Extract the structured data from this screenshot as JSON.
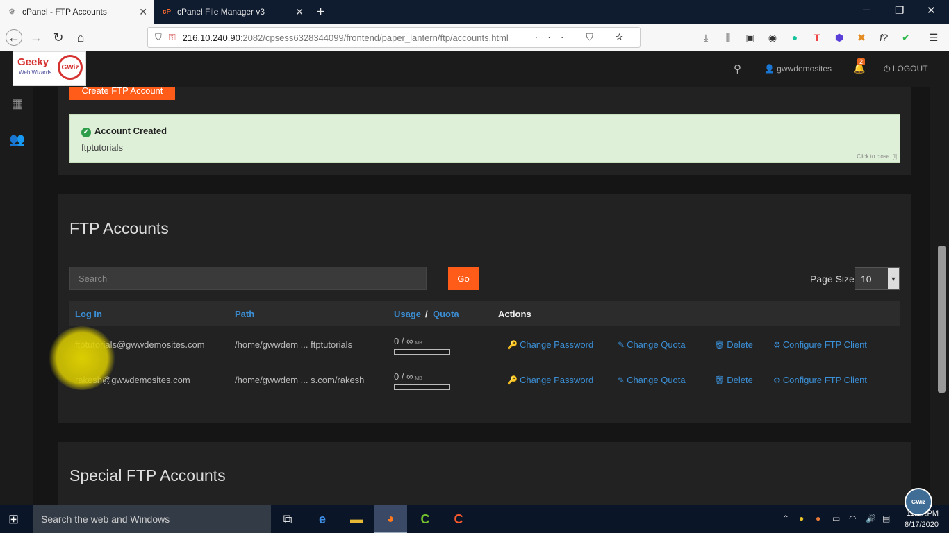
{
  "browser": {
    "tabs": [
      {
        "label": "cPanel - FTP Accounts",
        "active": true
      },
      {
        "label": "cPanel File Manager v3",
        "active": false
      }
    ],
    "new_tab": "+",
    "url_host": "216.10.240.90",
    "url_rest": ":2082/cpsess6328344099/frontend/paper_lantern/ftp/accounts.html",
    "window_controls": {
      "minimize": "─",
      "maximize": "❐",
      "close": "✕"
    },
    "url_actions": "··· ⛉ ☆"
  },
  "logo": {
    "name": "Geeky",
    "tagline": "Web Wizards",
    "mark": "GWiz"
  },
  "header": {
    "username": "gwwdemosites",
    "notifications_count": "2",
    "logout_label": "LOGOUT"
  },
  "actions": {
    "create_button": "Create FTP Account"
  },
  "alert": {
    "title": "Account Created",
    "message": "ftptutorials",
    "close_hint": "Click to close. [l]"
  },
  "ftp_accounts": {
    "title": "FTP Accounts",
    "search_placeholder": "Search",
    "go_label": "Go",
    "page_size_label": "Page Size",
    "page_size_value": "10",
    "columns": {
      "login": "Log In",
      "path": "Path",
      "usage": "Usage",
      "sep": "/",
      "quota": "Quota",
      "actions": "Actions"
    },
    "rows": [
      {
        "login": "ftptutorials@gwwdemosites.com",
        "path": "/home/gwwdem ... ftptutorials",
        "usage": "0 / ∞",
        "unit": "MB",
        "usage_fraction": 0
      },
      {
        "login": "rakesh@gwwdemosites.com",
        "path": "/home/gwwdem ... s.com/rakesh",
        "usage": "0 / ∞",
        "unit": "MB",
        "usage_fraction": 0
      }
    ],
    "row_actions": {
      "change_password": "Change Password",
      "change_quota": "Change Quota",
      "delete": "Delete",
      "configure": "Configure FTP Client"
    }
  },
  "special_ftp": {
    "title": "Special FTP Accounts"
  },
  "taskbar": {
    "search_placeholder": "Search the web and Windows",
    "time": "11:??:PM",
    "date": "8/17/2020"
  },
  "colors": {
    "accent_orange": "#ff5c1a",
    "link_blue": "#3b8fd6",
    "success_bg": "#dff0d8"
  }
}
